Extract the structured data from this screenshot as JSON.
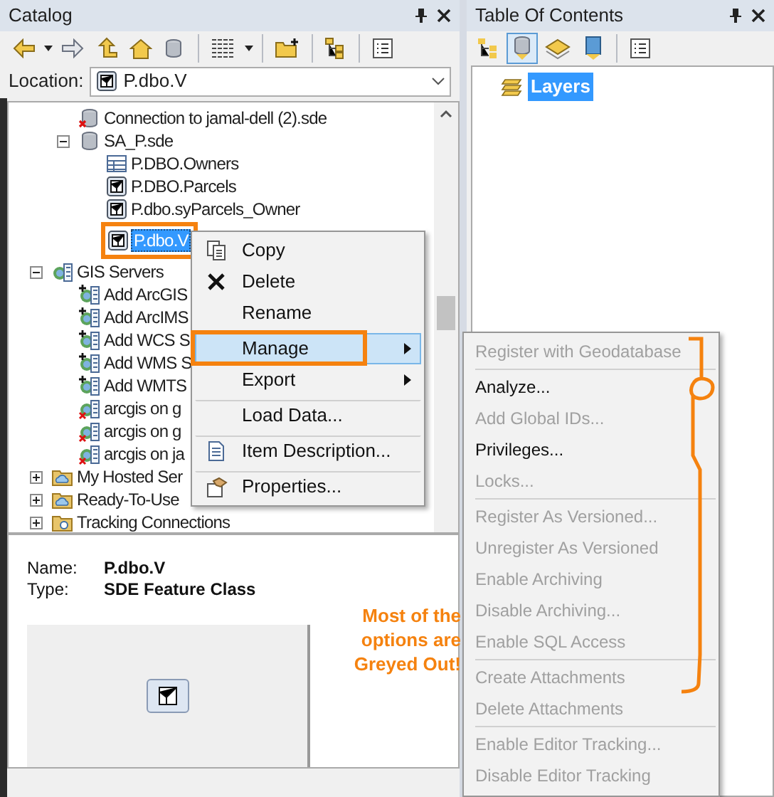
{
  "catalog": {
    "title": "Catalog",
    "location_label": "Location:",
    "location_value": "P.dbo.V",
    "tree": {
      "continued": [
        {
          "label": "Connection to jamal-dell (2).sde",
          "kind": "db-error",
          "selected": false
        },
        {
          "label": "SA_P.sde",
          "kind": "database",
          "selected": false,
          "expanded": true,
          "children": [
            {
              "label": "P.DBO.Owners",
              "kind": "table",
              "selected": false
            },
            {
              "label": "P.DBO.Parcels",
              "kind": "feature-class",
              "selected": false
            },
            {
              "label": "P.dbo.syParcels_Owner",
              "kind": "feature-class",
              "selected": false
            },
            {
              "label": "P.dbo.V",
              "kind": "feature-class",
              "selected": true,
              "highlighted": true
            }
          ]
        }
      ],
      "roots": [
        {
          "label": "GIS Servers",
          "kind": "servers",
          "selected": false,
          "expanded": true,
          "children": [
            {
              "label": "Add ArcGIS",
              "kind": "add-server",
              "selected": false
            },
            {
              "label": "Add ArcIMS",
              "kind": "add-server",
              "selected": false
            },
            {
              "label": "Add WCS S",
              "kind": "add-server",
              "selected": false
            },
            {
              "label": "Add WMS S",
              "kind": "add-server",
              "selected": false
            },
            {
              "label": "Add WMTS",
              "kind": "add-server",
              "selected": false
            },
            {
              "label": "arcgis on g",
              "kind": "server-error",
              "selected": false
            },
            {
              "label": "arcgis on g",
              "kind": "server-error",
              "selected": false
            },
            {
              "label": "arcgis on ja",
              "kind": "server-error",
              "selected": false
            }
          ]
        },
        {
          "label": "My Hosted Ser",
          "kind": "folder-cloud",
          "selected": false,
          "expanded": false
        },
        {
          "label": "Ready-To-Use",
          "kind": "folder-cloud",
          "selected": false,
          "expanded": false
        },
        {
          "label": "Tracking Connections",
          "kind": "folder-tracking",
          "selected": false,
          "expanded": false
        }
      ]
    },
    "details": {
      "name_label": "Name:",
      "name_value": "P.dbo.V",
      "type_label": "Type:",
      "type_value": "SDE Feature Class"
    }
  },
  "toc": {
    "title": "Table Of Contents",
    "layers": [
      {
        "label": "Layers",
        "selected": true
      }
    ]
  },
  "context_menu": {
    "items": [
      {
        "label": "Copy",
        "kind": "copy",
        "selected": false,
        "has_submenu": false,
        "separator_before": false
      },
      {
        "label": "Delete",
        "kind": "delete",
        "selected": false,
        "has_submenu": false,
        "separator_before": false
      },
      {
        "label": "Rename",
        "kind": "plain",
        "selected": false,
        "has_submenu": false,
        "separator_before": false
      },
      {
        "label": "Manage",
        "kind": "plain",
        "selected": true,
        "has_submenu": true,
        "separator_before": true
      },
      {
        "label": "Export",
        "kind": "plain",
        "selected": false,
        "has_submenu": true,
        "separator_before": false
      },
      {
        "label": "Load Data...",
        "kind": "plain",
        "selected": false,
        "has_submenu": false,
        "separator_before": true
      },
      {
        "label": "Item Description...",
        "kind": "document",
        "selected": false,
        "has_submenu": false,
        "separator_before": true
      },
      {
        "label": "Properties...",
        "kind": "properties",
        "selected": false,
        "has_submenu": false,
        "separator_before": true
      }
    ]
  },
  "submenu": {
    "items": [
      {
        "label": "Register with Geodatabase",
        "disabled": true,
        "separator_before": false
      },
      {
        "label": "Analyze...",
        "disabled": false,
        "separator_before": true
      },
      {
        "label": "Add Global IDs...",
        "disabled": true,
        "separator_before": false
      },
      {
        "label": "Privileges...",
        "disabled": false,
        "separator_before": false
      },
      {
        "label": "Locks...",
        "disabled": true,
        "separator_before": false
      },
      {
        "label": "Register As Versioned...",
        "disabled": true,
        "separator_before": true
      },
      {
        "label": "Unregister As Versioned",
        "disabled": true,
        "separator_before": false
      },
      {
        "label": "Enable Archiving",
        "disabled": true,
        "separator_before": false
      },
      {
        "label": "Disable Archiving...",
        "disabled": true,
        "separator_before": false
      },
      {
        "label": "Enable SQL Access",
        "disabled": true,
        "separator_before": false
      },
      {
        "label": "Create Attachments",
        "disabled": true,
        "separator_before": true
      },
      {
        "label": "Delete Attachments",
        "disabled": true,
        "separator_before": false
      },
      {
        "label": "Enable Editor Tracking...",
        "disabled": true,
        "separator_before": true
      },
      {
        "label": "Disable Editor Tracking",
        "disabled": true,
        "separator_before": false
      }
    ]
  },
  "annotation": {
    "lines": [
      "Most of the options are",
      "Greyed Out!"
    ]
  }
}
